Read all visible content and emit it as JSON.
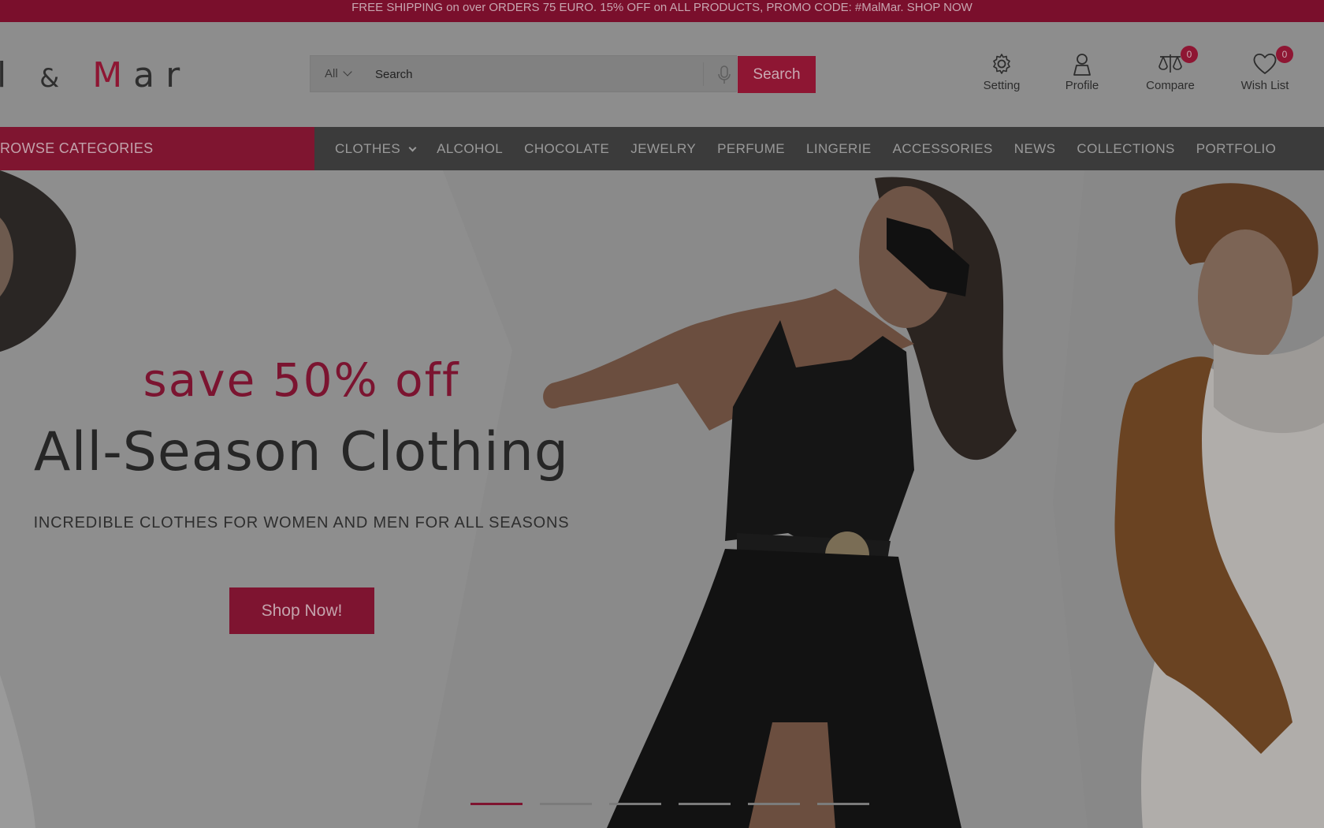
{
  "promo": {
    "text": "FREE SHIPPING on over ORDERS 75 EURO. 15% OFF on ALL PRODUCTS, PROMO CODE: #MalMar. SHOP NOW"
  },
  "logo": {
    "part1": "l",
    "amp": "&",
    "part2": "M",
    "part3": "ar"
  },
  "search": {
    "category": "All",
    "placeholder": "Search",
    "button": "Search"
  },
  "header_icons": [
    {
      "label": "Setting",
      "icon": "gear-icon"
    },
    {
      "label": "Profile",
      "icon": "user-icon"
    },
    {
      "label": "Compare",
      "icon": "scale-icon",
      "count": "0"
    },
    {
      "label": "Wish List",
      "icon": "heart-icon",
      "count": "0"
    }
  ],
  "nav": {
    "browse": "ROWSE CATEGORIES",
    "items": [
      "CLOTHES",
      "ALCOHOL",
      "CHOCOLATE",
      "JEWELRY",
      "PERFUME",
      "LINGERIE",
      "ACCESSORIES",
      "NEWS",
      "COLLECTIONS",
      "PORTFOLIO"
    ]
  },
  "hero": {
    "save": "save 50% off",
    "headline": "All-Season Clothing",
    "subline": "INCREDIBLE CLOTHES FOR WOMEN AND MEN FOR ALL SEASONS",
    "cta": "Shop Now!",
    "slides": 6,
    "active_slide": 1
  },
  "colors": {
    "accent": "#8e1633",
    "nav_bg": "#3b3b3b",
    "overlay": "#8d8d8d"
  }
}
